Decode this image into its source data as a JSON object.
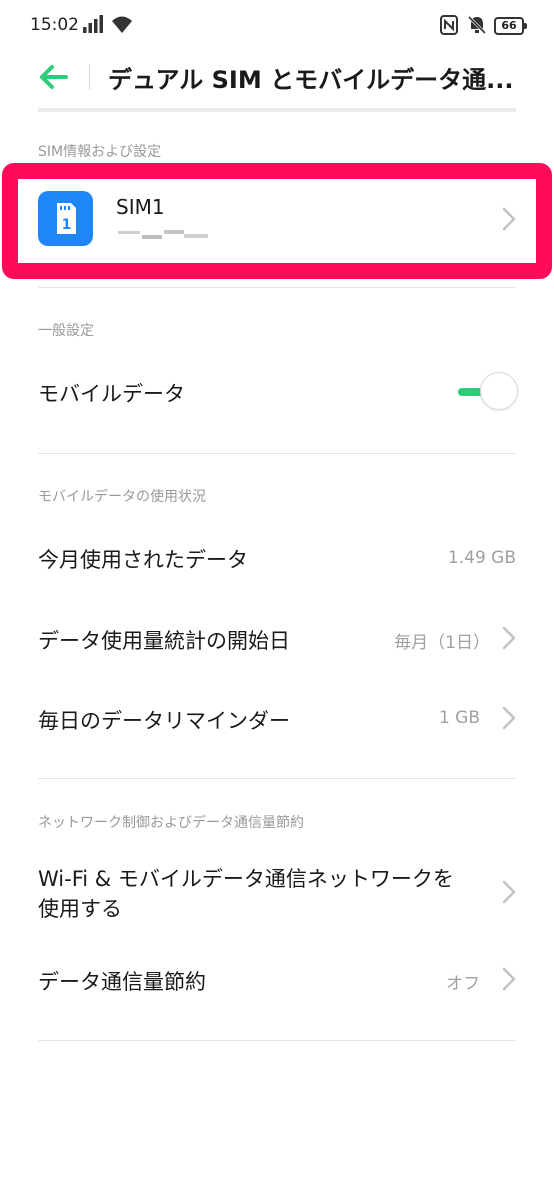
{
  "status_bar": {
    "time": "15:02",
    "battery": "66",
    "icons": [
      "signal-icon",
      "wifi-icon",
      "nfc-icon",
      "vibrate-mute-icon",
      "battery-icon"
    ]
  },
  "header": {
    "title": "デュアル SIM とモバイルデータ通...",
    "back_icon": "back-arrow-icon"
  },
  "sim_section": {
    "label": "SIM情報および設定",
    "sim": {
      "name": "SIM1",
      "icon_number": "1"
    }
  },
  "general_section": {
    "label": "一般設定",
    "mobile_data": {
      "label": "モバイルデータ",
      "enabled": true
    }
  },
  "usage_section": {
    "label": "モバイルデータの使用状況",
    "items": [
      {
        "label": "今月使用されたデータ",
        "value": "1.49 GB"
      },
      {
        "label": "データ使用量統計の開始日",
        "value": "毎月（1日）"
      },
      {
        "label": "毎日のデータリマインダー",
        "value": "1 GB"
      }
    ]
  },
  "network_section": {
    "label": "ネットワーク制御およびデータ通信量節約",
    "items": [
      {
        "label_line1": "Wi-Fi & モバイルデータ通信ネットワークを",
        "label_line2": "使用する"
      },
      {
        "label": "データ通信量節約",
        "value": "オフ"
      }
    ]
  },
  "colors": {
    "accent_green": "#2ecb7a",
    "highlight": "#fe0b5a",
    "sim_icon_bg": "#1e86f5"
  }
}
